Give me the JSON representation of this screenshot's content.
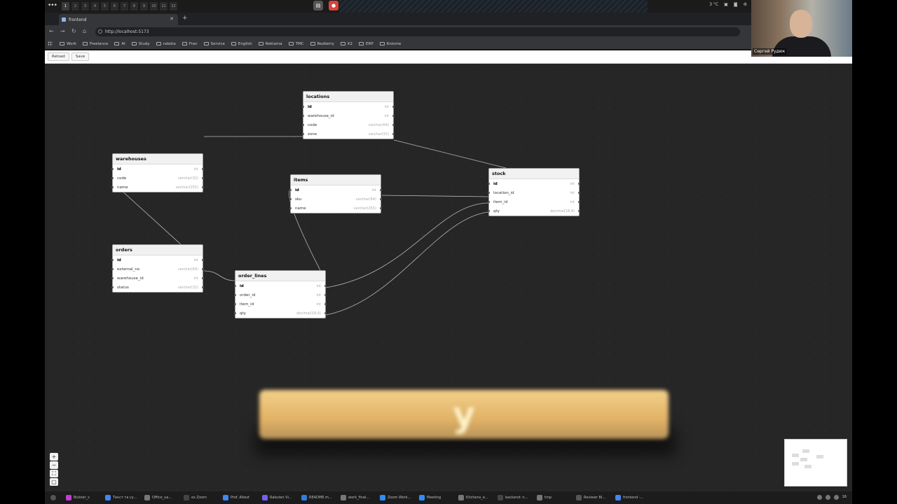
{
  "system": {
    "workspaces": [
      "1",
      "2",
      "3",
      "4",
      "5",
      "6",
      "7",
      "8",
      "9",
      "10",
      "11",
      "12"
    ],
    "active_workspace": 0,
    "weather": "3 °C"
  },
  "browser": {
    "tab_title": "frontend",
    "url": "http://localhost:5173",
    "bookmarks": [
      "Work",
      "Freelance",
      "AI",
      "Study",
      "rabota",
      "Fran",
      "Service",
      "English",
      "Reklama",
      "TMC",
      "Rezberry",
      "K2",
      "ERP",
      "Kniome"
    ]
  },
  "toolbar": {
    "reload_label": "Reload",
    "save_label": "Save"
  },
  "tables": [
    {
      "name": "locations",
      "columns": [
        {
          "name": "id",
          "type": "int",
          "pk": true
        },
        {
          "name": "warehouse_id",
          "type": "int"
        },
        {
          "name": "code",
          "type": "varchar(64)"
        },
        {
          "name": "zone",
          "type": "varchar(32)"
        }
      ]
    },
    {
      "name": "warehouses",
      "columns": [
        {
          "name": "id",
          "type": "int",
          "pk": true
        },
        {
          "name": "code",
          "type": "varchar(32)"
        },
        {
          "name": "name",
          "type": "varchar(255)"
        }
      ]
    },
    {
      "name": "items",
      "columns": [
        {
          "name": "id",
          "type": "int",
          "pk": true
        },
        {
          "name": "sku",
          "type": "varchar(64)"
        },
        {
          "name": "name",
          "type": "varchar(255)"
        }
      ]
    },
    {
      "name": "stock",
      "columns": [
        {
          "name": "id",
          "type": "int",
          "pk": true
        },
        {
          "name": "location_id",
          "type": "int"
        },
        {
          "name": "item_id",
          "type": "int"
        },
        {
          "name": "qty",
          "type": "decimal(18,4)"
        }
      ]
    },
    {
      "name": "orders",
      "columns": [
        {
          "name": "id",
          "type": "int",
          "pk": true
        },
        {
          "name": "external_no",
          "type": "varchar(64)"
        },
        {
          "name": "warehouse_id",
          "type": "int"
        },
        {
          "name": "status",
          "type": "varchar(32)"
        }
      ]
    },
    {
      "name": "order_lines",
      "columns": [
        {
          "name": "id",
          "type": "int",
          "pk": true
        },
        {
          "name": "order_id",
          "type": "int"
        },
        {
          "name": "item_id",
          "type": "int"
        },
        {
          "name": "qty",
          "type": "decimal(18,4)"
        }
      ]
    }
  ],
  "caption_overlay": "y",
  "taskbar": {
    "items": [
      "Bolster_s",
      "Текст та су...",
      "Office_ua...",
      "ex Zoom",
      "Prof. Altest",
      "Rakuten Vi...",
      "README.m...",
      "work_final...",
      "Zoom Work...",
      "Meeting",
      "Kitchens_e...",
      "backend: n...",
      "tmp",
      "Reviewr Bi...",
      "frontend -..."
    ],
    "colors": [
      "#c23bd4",
      "#4285f4",
      "#777777",
      "#444444",
      "#4285f4",
      "#7360f2",
      "#2d7fe0",
      "#777777",
      "#2d8cff",
      "#2d8cff",
      "#777777",
      "#444444",
      "#777777",
      "#555555",
      "#4285f4"
    ],
    "tray_label": "16"
  },
  "webcam": {
    "name": "Сергей Рудюк"
  }
}
